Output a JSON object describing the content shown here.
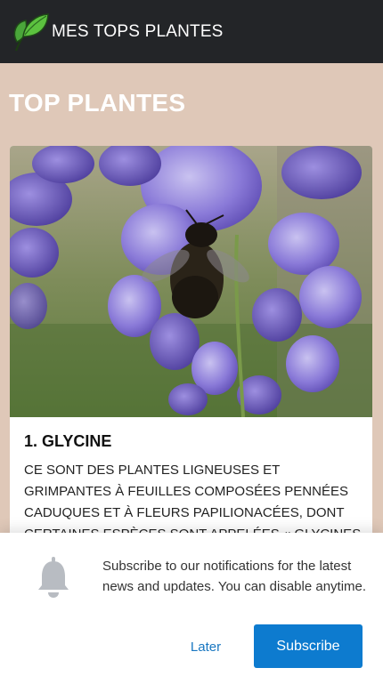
{
  "navbar": {
    "brand": "MES TOPS PLANTES",
    "logo_icon": "leaf-logo-icon",
    "colors": {
      "background": "#232528",
      "text": "#ffffff"
    }
  },
  "page": {
    "title": "TOP PLANTES",
    "background": "#dfc8b8"
  },
  "card": {
    "image_subject": "wisteria-flowers-with-bee",
    "title": "1. GLYCINE",
    "text": "CE SONT DES PLANTES LIGNEUSES ET GRIMPANTES À FEUILLES COMPOSÉES PENNÉES CADUQUES ET À FLEURS PAPILIONACÉES, DONT CERTAINES ESPÈCES SONT APPELÉES « GLYCINES ». CERTAINES D'ENTRE"
  },
  "notification_prompt": {
    "icon": "bell-icon",
    "message": "Subscribe to our notifications for the latest news and updates. You can disable anytime.",
    "later_label": "Later",
    "subscribe_label": "Subscribe",
    "colors": {
      "accent": "#0d7bcf",
      "later_text": "#1977c1"
    }
  }
}
